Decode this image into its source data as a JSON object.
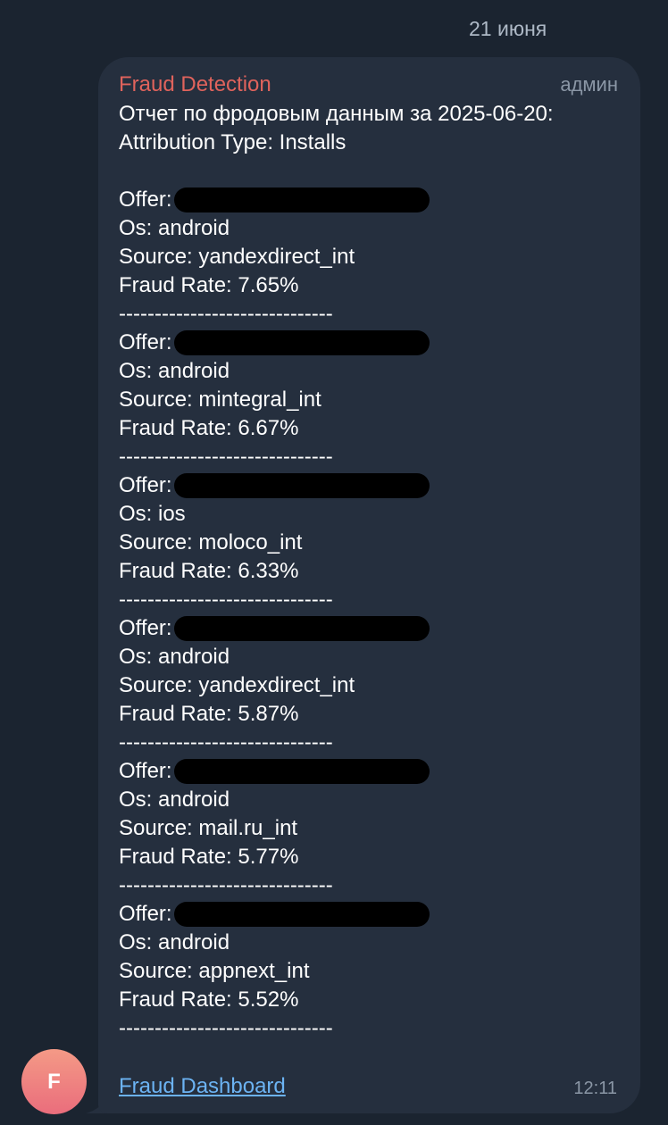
{
  "date_header": "21 июня",
  "message": {
    "sender": "Fraud Detection",
    "badge": "админ",
    "title_line": "Отчет по фродовым данным за 2025-06-20:",
    "attribution_line": "Attribution Type: Installs",
    "divider": "------------------------------",
    "entries": [
      {
        "offer_label": "Offer:",
        "os": "Os: android",
        "source": "Source: yandexdirect_int",
        "fraud_rate": "Fraud Rate: 7.65%"
      },
      {
        "offer_label": "Offer:",
        "os": "Os: android",
        "source": "Source: mintegral_int",
        "fraud_rate": "Fraud Rate: 6.67%"
      },
      {
        "offer_label": "Offer:",
        "os": "Os: ios",
        "source": "Source: moloco_int",
        "fraud_rate": "Fraud Rate: 6.33%"
      },
      {
        "offer_label": "Offer:",
        "os": "Os: android",
        "source": "Source: yandexdirect_int",
        "fraud_rate": "Fraud Rate: 5.87%"
      },
      {
        "offer_label": "Offer:",
        "os": "Os: android",
        "source": "Source: mail.ru_int",
        "fraud_rate": "Fraud Rate: 5.77%"
      },
      {
        "offer_label": "Offer:",
        "os": "Os: android",
        "source": "Source: appnext_int",
        "fraud_rate": "Fraud Rate: 5.52%"
      }
    ],
    "link_text": "Fraud Dashboard",
    "time": "12:11"
  },
  "avatar": {
    "letter": "F"
  },
  "colors": {
    "background": "#1b2430",
    "bubble": "#252f3e",
    "sender": "#e0635c",
    "link": "#6cb3f3",
    "meta": "#8b97a6"
  }
}
